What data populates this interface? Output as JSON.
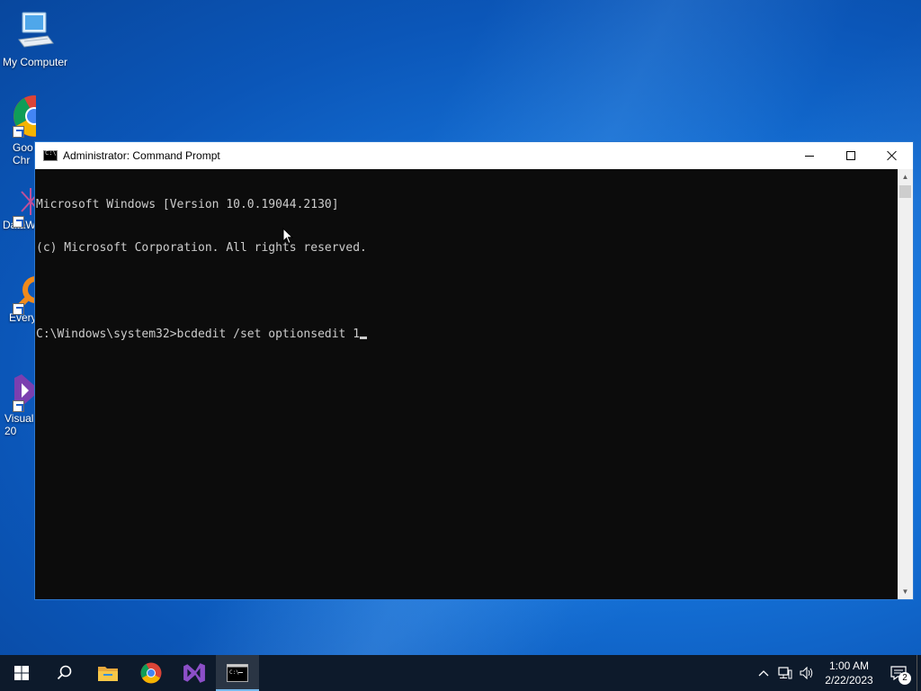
{
  "desktop": {
    "icons": [
      {
        "label": "My Computer"
      },
      {
        "label": "Google Chrome",
        "visible": "Goo\nChr"
      },
      {
        "label": "DataW",
        "visible": "DataW"
      },
      {
        "label": "Every",
        "visible": "Every"
      },
      {
        "label": "Visual",
        "visible": "Visual\n20"
      }
    ]
  },
  "window": {
    "title": "Administrator: Command Prompt",
    "console_lines": [
      "Microsoft Windows [Version 10.0.19044.2130]",
      "(c) Microsoft Corporation. All rights reserved.",
      "",
      "C:\\Windows\\system32>bcdedit /set optionsedit 1"
    ]
  },
  "taskbar": {
    "items": [
      "start-icon",
      "search-icon",
      "file-explorer-icon",
      "chrome-icon",
      "visual-studio-icon",
      "command-prompt-icon"
    ],
    "clock_time": "1:00 AM",
    "clock_date": "2/22/2023",
    "notification_count": "2"
  },
  "colors": {
    "console_bg": "#0c0c0c",
    "console_fg": "#cccccc",
    "taskbar_bg": "#0d1a2b",
    "accent": "#76b9ed"
  }
}
